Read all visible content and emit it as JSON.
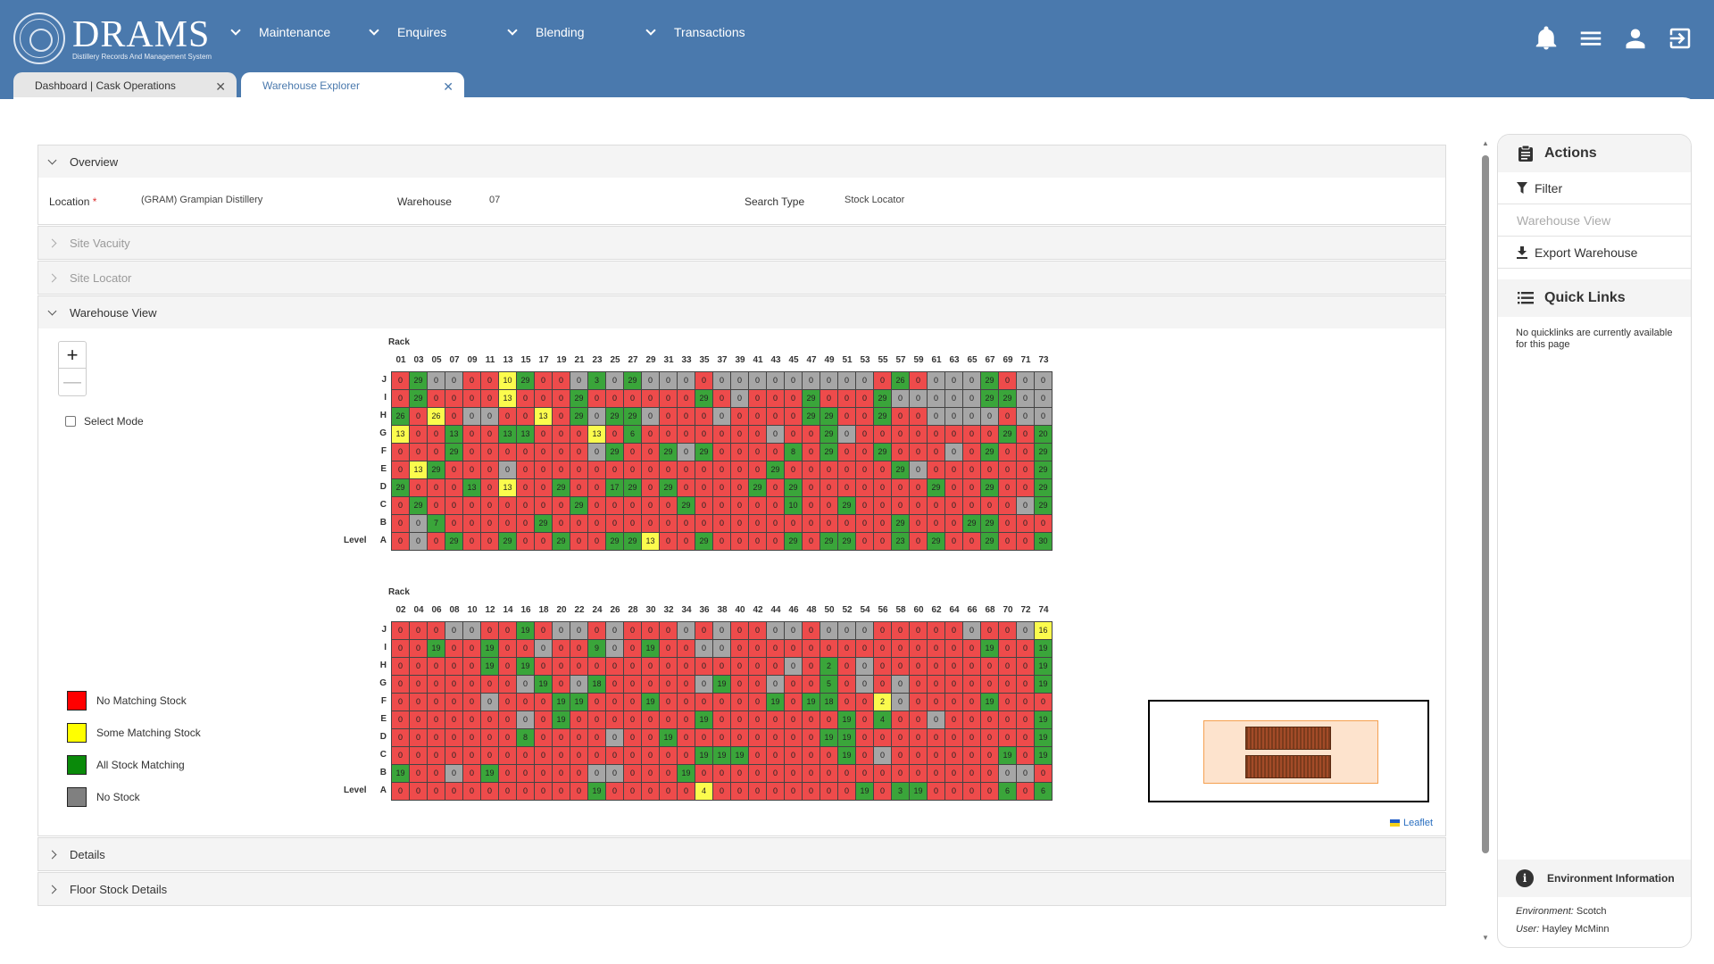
{
  "app": {
    "logo_title": "DRAMS",
    "logo_subtitle": "Distillery Records And Management System"
  },
  "nav": [
    {
      "label": "Maintenance"
    },
    {
      "label": "Enquires"
    },
    {
      "label": "Blending"
    },
    {
      "label": "Transactions"
    }
  ],
  "header_icons": [
    "bell-icon",
    "menu-icon",
    "user-icon",
    "logout-icon"
  ],
  "tabs": [
    {
      "label": "Dashboard | Cask Operations",
      "active": false
    },
    {
      "label": "Warehouse Explorer",
      "active": true
    }
  ],
  "panels": {
    "overview": "Overview",
    "site_vacuity": "Site Vacuity",
    "site_locator": "Site Locator",
    "warehouse_view": "Warehouse View",
    "details": "Details",
    "floor_stock": "Floor Stock Details"
  },
  "overview": {
    "location_label": "Location",
    "required_mark": "*",
    "location_value": "(GRAM) Grampian Distillery",
    "warehouse_label": "Warehouse",
    "warehouse_value": "07",
    "search_type_label": "Search Type",
    "search_type_value": "Stock Locator"
  },
  "map_controls": {
    "zoom_in": "+",
    "zoom_out": "—",
    "select_mode": "Select Mode",
    "attribution": "Leaflet"
  },
  "legend": [
    {
      "label": "No Matching Stock",
      "color": "#ff0000"
    },
    {
      "label": "Some Matching Stock",
      "color": "#ffff00"
    },
    {
      "label": "All Stock Matching",
      "color": "#0a8a0a"
    },
    {
      "label": "No Stock",
      "color": "#808080"
    }
  ],
  "cell_colors": {
    "r": "#ee4b4b",
    "y": "#fbfb4d",
    "g": "#3aa53a",
    "x": "#a6a6a6"
  },
  "rack_label": "Rack",
  "level_label": "Level",
  "levels": [
    "J",
    "I",
    "H",
    "G",
    "F",
    "E",
    "D",
    "C",
    "B",
    "A"
  ],
  "grid1": {
    "racks": [
      "01",
      "03",
      "05",
      "07",
      "09",
      "11",
      "13",
      "15",
      "17",
      "19",
      "21",
      "23",
      "25",
      "27",
      "29",
      "31",
      "33",
      "35",
      "37",
      "39",
      "41",
      "43",
      "45",
      "47",
      "49",
      "51",
      "53",
      "55",
      "57",
      "59",
      "61",
      "63",
      "65",
      "67",
      "69",
      "71",
      "73"
    ],
    "rows": [
      [
        "r0",
        "g29",
        "x0",
        "x0",
        "r0",
        "r0",
        "y10",
        "g29",
        "r0",
        "r0",
        "x0",
        "g3",
        "x0",
        "g29",
        "x0",
        "x0",
        "x0",
        "r0",
        "x0",
        "x0",
        "x0",
        "x0",
        "x0",
        "x0",
        "x0",
        "x0",
        "x0",
        "r0",
        "g26",
        "r0",
        "x0",
        "x0",
        "x0",
        "g29",
        "r0",
        "x0",
        "x0"
      ],
      [
        "r0",
        "g29",
        "r0",
        "r0",
        "r0",
        "r0",
        "y13",
        "r0",
        "r0",
        "r0",
        "g29",
        "r0",
        "r0",
        "r0",
        "r0",
        "r0",
        "r0",
        "g29",
        "r0",
        "x0",
        "r0",
        "r0",
        "r0",
        "g29",
        "r0",
        "r0",
        "r0",
        "g29",
        "x0",
        "x0",
        "x0",
        "x0",
        "x0",
        "g29",
        "g29",
        "x0",
        "x0"
      ],
      [
        "g26",
        "r0",
        "y26",
        "r0",
        "x0",
        "x0",
        "r0",
        "r0",
        "y13",
        "r0",
        "g29",
        "x0",
        "g29",
        "g29",
        "x0",
        "r0",
        "r0",
        "r0",
        "x0",
        "r0",
        "r0",
        "r0",
        "r0",
        "g29",
        "g29",
        "r0",
        "r0",
        "g29",
        "r0",
        "r0",
        "x0",
        "x0",
        "x0",
        "x0",
        "r0",
        "x0",
        "x0"
      ],
      [
        "y13",
        "r0",
        "r0",
        "g13",
        "r0",
        "r0",
        "g13",
        "g13",
        "r0",
        "r0",
        "r0",
        "y13",
        "r0",
        "g6",
        "r0",
        "r0",
        "r0",
        "r0",
        "r0",
        "r0",
        "r0",
        "x0",
        "r0",
        "r0",
        "g29",
        "x0",
        "r0",
        "r0",
        "r0",
        "r0",
        "r0",
        "r0",
        "r0",
        "r0",
        "g29",
        "r0",
        "g20"
      ],
      [
        "r0",
        "r0",
        "r0",
        "g29",
        "r0",
        "r0",
        "r0",
        "r0",
        "r0",
        "r0",
        "r0",
        "x0",
        "g29",
        "r0",
        "r0",
        "g29",
        "x0",
        "g29",
        "r0",
        "r0",
        "r0",
        "r0",
        "g8",
        "r0",
        "g29",
        "r0",
        "r0",
        "g29",
        "r0",
        "r0",
        "r0",
        "x0",
        "r0",
        "g29",
        "r0",
        "r0",
        "g29"
      ],
      [
        "r0",
        "y13",
        "g29",
        "r0",
        "r0",
        "r0",
        "x0",
        "r0",
        "r0",
        "r0",
        "r0",
        "r0",
        "r0",
        "r0",
        "r0",
        "r0",
        "r0",
        "r0",
        "r0",
        "r0",
        "r0",
        "g29",
        "r0",
        "r0",
        "r0",
        "r0",
        "r0",
        "r0",
        "g29",
        "x0",
        "r0",
        "r0",
        "r0",
        "r0",
        "r0",
        "r0",
        "g29"
      ],
      [
        "g29",
        "r0",
        "r0",
        "r0",
        "g13",
        "r0",
        "y13",
        "r0",
        "r0",
        "g29",
        "r0",
        "r0",
        "g17",
        "g29",
        "r0",
        "g29",
        "r0",
        "r0",
        "r0",
        "r0",
        "g29",
        "r0",
        "g29",
        "r0",
        "r0",
        "r0",
        "r0",
        "r0",
        "r0",
        "r0",
        "g29",
        "r0",
        "r0",
        "g29",
        "r0",
        "r0",
        "g29"
      ],
      [
        "r0",
        "g29",
        "r0",
        "r0",
        "r0",
        "r0",
        "r0",
        "r0",
        "r0",
        "r0",
        "g29",
        "r0",
        "r0",
        "r0",
        "r0",
        "r0",
        "g29",
        "r0",
        "r0",
        "r0",
        "r0",
        "r0",
        "g10",
        "r0",
        "r0",
        "g29",
        "r0",
        "r0",
        "r0",
        "r0",
        "r0",
        "r0",
        "r0",
        "r0",
        "r0",
        "x0",
        "g29"
      ],
      [
        "r0",
        "x0",
        "g7",
        "r0",
        "r0",
        "r0",
        "r0",
        "r0",
        "g29",
        "r0",
        "r0",
        "r0",
        "r0",
        "r0",
        "r0",
        "r0",
        "r0",
        "r0",
        "r0",
        "r0",
        "r0",
        "r0",
        "r0",
        "r0",
        "r0",
        "r0",
        "r0",
        "r0",
        "g29",
        "r0",
        "r0",
        "r0",
        "g29",
        "g29",
        "r0",
        "r0",
        "r0"
      ],
      [
        "r0",
        "x0",
        "r0",
        "g29",
        "r0",
        "r0",
        "g29",
        "r0",
        "r0",
        "g29",
        "r0",
        "r0",
        "g29",
        "g29",
        "y13",
        "r0",
        "r0",
        "g29",
        "r0",
        "r0",
        "r0",
        "r0",
        "g29",
        "r0",
        "g29",
        "g29",
        "r0",
        "r0",
        "g23",
        "r0",
        "g29",
        "r0",
        "r0",
        "g29",
        "r0",
        "r0",
        "g30"
      ]
    ]
  },
  "grid2": {
    "racks": [
      "02",
      "04",
      "06",
      "08",
      "10",
      "12",
      "14",
      "16",
      "18",
      "20",
      "22",
      "24",
      "26",
      "28",
      "30",
      "32",
      "34",
      "36",
      "38",
      "40",
      "42",
      "44",
      "46",
      "48",
      "50",
      "52",
      "54",
      "56",
      "58",
      "60",
      "62",
      "64",
      "66",
      "68",
      "70",
      "72",
      "74"
    ],
    "rows": [
      [
        "r0",
        "r0",
        "r0",
        "x0",
        "x0",
        "r0",
        "r0",
        "g19",
        "r0",
        "x0",
        "x0",
        "r0",
        "x0",
        "r0",
        "r0",
        "r0",
        "x0",
        "r0",
        "x0",
        "r0",
        "r0",
        "x0",
        "x0",
        "r0",
        "x0",
        "x0",
        "x0",
        "r0",
        "r0",
        "r0",
        "r0",
        "r0",
        "x0",
        "r0",
        "r0",
        "x0",
        "y16"
      ],
      [
        "r0",
        "r0",
        "g19",
        "r0",
        "r0",
        "g19",
        "r0",
        "r0",
        "x0",
        "r0",
        "r0",
        "g9",
        "x0",
        "r0",
        "g19",
        "r0",
        "r0",
        "x0",
        "x0",
        "r0",
        "r0",
        "r0",
        "r0",
        "r0",
        "r0",
        "r0",
        "r0",
        "r0",
        "r0",
        "r0",
        "r0",
        "r0",
        "r0",
        "g19",
        "r0",
        "r0",
        "g19"
      ],
      [
        "r0",
        "r0",
        "r0",
        "r0",
        "r0",
        "g19",
        "r0",
        "g19",
        "r0",
        "r0",
        "r0",
        "r0",
        "r0",
        "r0",
        "r0",
        "r0",
        "r0",
        "r0",
        "r0",
        "r0",
        "r0",
        "r0",
        "x0",
        "r0",
        "g2",
        "r0",
        "x0",
        "r0",
        "r0",
        "r0",
        "r0",
        "r0",
        "r0",
        "r0",
        "r0",
        "r0",
        "g19"
      ],
      [
        "r0",
        "r0",
        "r0",
        "r0",
        "r0",
        "r0",
        "r0",
        "x0",
        "g19",
        "r0",
        "x0",
        "g18",
        "r0",
        "r0",
        "r0",
        "r0",
        "r0",
        "x0",
        "g19",
        "r0",
        "r0",
        "x0",
        "r0",
        "r0",
        "g5",
        "r0",
        "x0",
        "r0",
        "x0",
        "r0",
        "r0",
        "r0",
        "r0",
        "r0",
        "r0",
        "r0",
        "g19"
      ],
      [
        "r0",
        "r0",
        "r0",
        "r0",
        "r0",
        "x0",
        "r0",
        "r0",
        "r0",
        "g19",
        "g19",
        "r0",
        "r0",
        "r0",
        "g19",
        "r0",
        "r0",
        "r0",
        "r0",
        "r0",
        "r0",
        "g19",
        "r0",
        "g19",
        "g18",
        "r0",
        "r0",
        "y2",
        "x0",
        "r0",
        "r0",
        "r0",
        "r0",
        "g19",
        "r0",
        "r0",
        "r0"
      ],
      [
        "r0",
        "r0",
        "r0",
        "r0",
        "r0",
        "r0",
        "r0",
        "x0",
        "r0",
        "g19",
        "r0",
        "r0",
        "r0",
        "r0",
        "r0",
        "r0",
        "r0",
        "g19",
        "r0",
        "r0",
        "r0",
        "r0",
        "r0",
        "r0",
        "r0",
        "g19",
        "r0",
        "g4",
        "r0",
        "r0",
        "x0",
        "r0",
        "r0",
        "r0",
        "r0",
        "r0",
        "g19"
      ],
      [
        "r0",
        "r0",
        "r0",
        "r0",
        "r0",
        "r0",
        "r0",
        "g8",
        "r0",
        "r0",
        "r0",
        "r0",
        "x0",
        "r0",
        "r0",
        "g19",
        "r0",
        "r0",
        "r0",
        "r0",
        "r0",
        "r0",
        "r0",
        "r0",
        "g19",
        "g19",
        "r0",
        "r0",
        "r0",
        "r0",
        "r0",
        "r0",
        "r0",
        "r0",
        "r0",
        "r0",
        "g19"
      ],
      [
        "r0",
        "r0",
        "r0",
        "r0",
        "r0",
        "r0",
        "r0",
        "r0",
        "r0",
        "r0",
        "r0",
        "r0",
        "r0",
        "r0",
        "r0",
        "r0",
        "r0",
        "g19",
        "g19",
        "g19",
        "r0",
        "r0",
        "r0",
        "r0",
        "r0",
        "g19",
        "r0",
        "x0",
        "r0",
        "r0",
        "r0",
        "r0",
        "r0",
        "r0",
        "g19",
        "r0",
        "g19"
      ],
      [
        "g19",
        "r0",
        "r0",
        "x0",
        "r0",
        "g19",
        "r0",
        "r0",
        "r0",
        "r0",
        "r0",
        "x0",
        "x0",
        "r0",
        "r0",
        "r0",
        "g19",
        "r0",
        "r0",
        "r0",
        "r0",
        "r0",
        "r0",
        "r0",
        "r0",
        "r0",
        "r0",
        "r0",
        "r0",
        "r0",
        "r0",
        "r0",
        "r0",
        "r0",
        "x0",
        "x0",
        "r0"
      ],
      [
        "r0",
        "r0",
        "r0",
        "r0",
        "r0",
        "r0",
        "r0",
        "r0",
        "r0",
        "r0",
        "r0",
        "g19",
        "r0",
        "r0",
        "r0",
        "r0",
        "r0",
        "y4",
        "r0",
        "r0",
        "r0",
        "r0",
        "r0",
        "r0",
        "r0",
        "r0",
        "g19",
        "r0",
        "g3",
        "g19",
        "r0",
        "r0",
        "r0",
        "r0",
        "g6",
        "r0",
        "g6"
      ]
    ]
  },
  "sidebar": {
    "actions_title": "Actions",
    "filter": "Filter",
    "warehouse_view": "Warehouse View",
    "export": "Export Warehouse",
    "quick_links_title": "Quick Links",
    "quick_links_note": "No quicklinks are currently available for this page",
    "env_title": "Environment Information",
    "env_label": "Environment:",
    "env_value": "Scotch",
    "user_label": "User:",
    "user_value": "Hayley McMinn"
  }
}
